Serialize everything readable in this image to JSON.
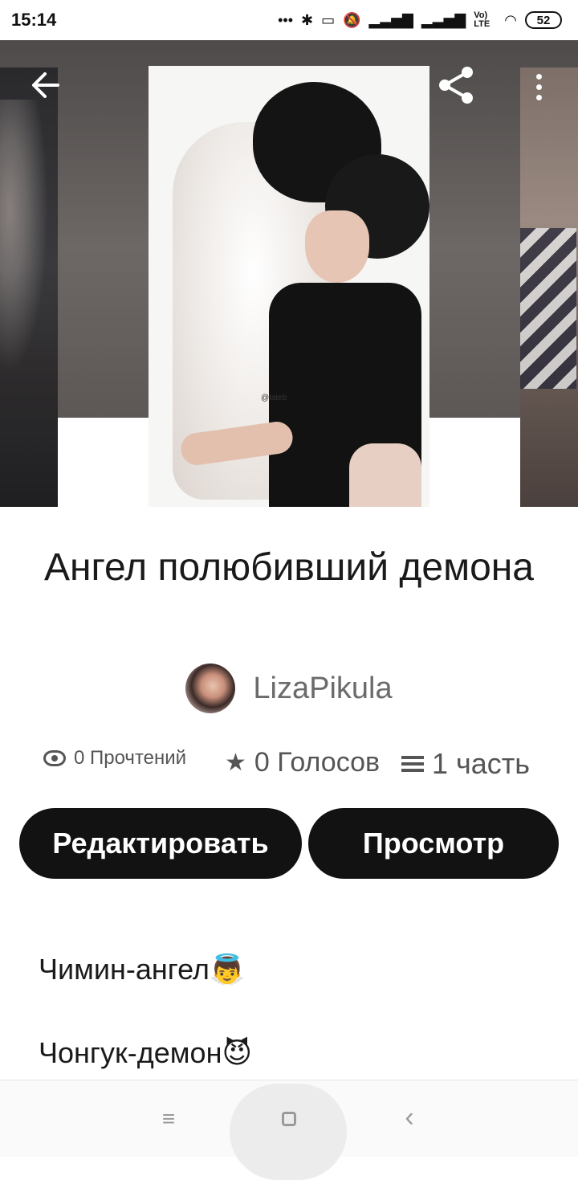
{
  "status_bar": {
    "time": "15:14",
    "dots": "•••",
    "bluetooth": "✱",
    "lte": "Vo) LTE",
    "battery": "52"
  },
  "story": {
    "title": "Ангел полюбивший демона",
    "author": "LizaPikula",
    "watermark": "@tateb"
  },
  "stats": {
    "reads": "0 Прочтений",
    "votes": "0 Голосов",
    "parts": "1 часть"
  },
  "actions": {
    "edit_label": "Редактировать",
    "view_label": "Просмотр"
  },
  "description": {
    "line1": "Чимин-ангел👼",
    "line2": "Чонгук-демон😈"
  },
  "icons": {
    "back": "back-arrow-icon",
    "share": "share-icon",
    "more": "more-vertical-icon"
  },
  "colors": {
    "button_bg": "#121212",
    "hero_bg": "#5d5856"
  }
}
